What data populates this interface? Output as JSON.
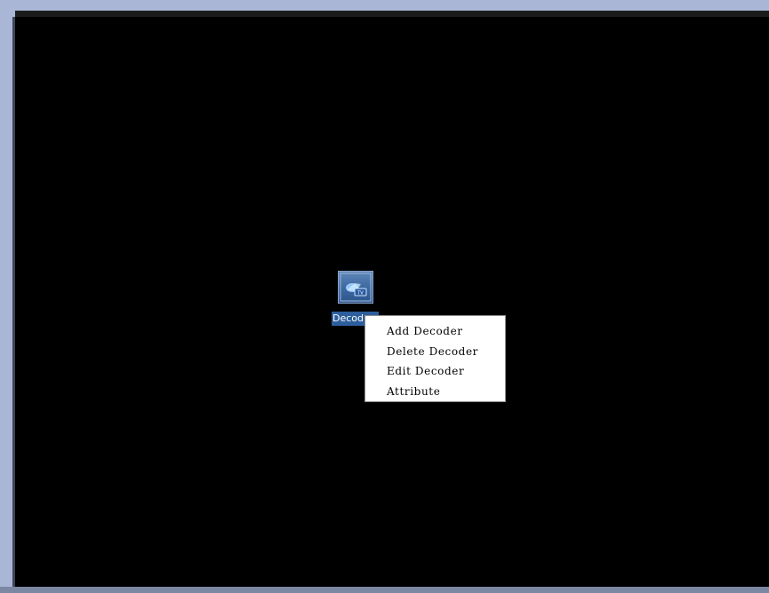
{
  "desktop": {
    "background_color": "#000000",
    "icon": {
      "name": "decoder-tv-icon",
      "label": "Decod"
    }
  },
  "context_menu": {
    "items": [
      {
        "label": "Add Decoder"
      },
      {
        "label": "Delete Decoder"
      },
      {
        "label": "Edit Decoder"
      },
      {
        "label": "Attribute"
      }
    ]
  }
}
